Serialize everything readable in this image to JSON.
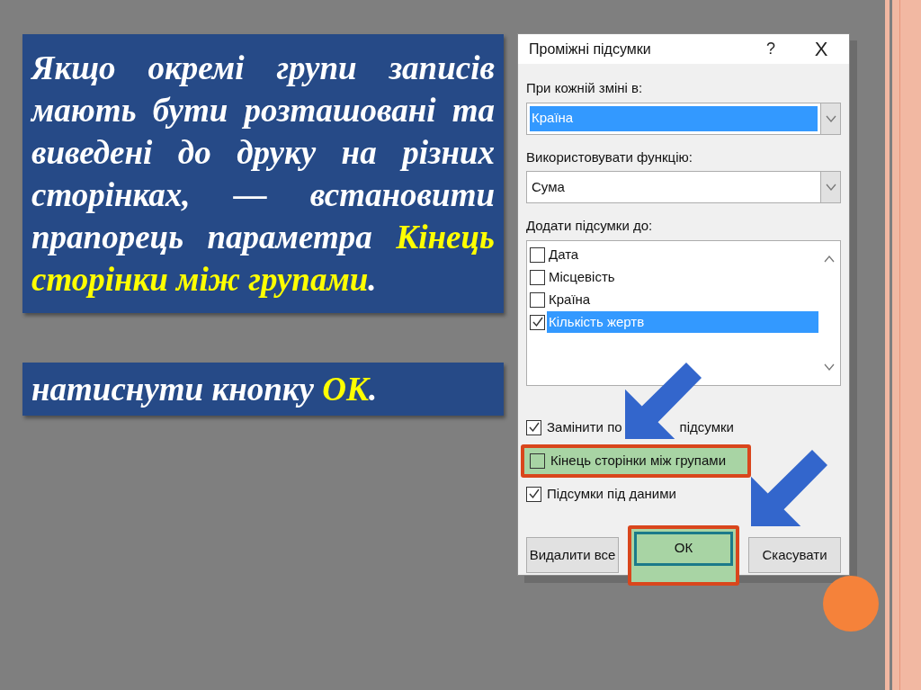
{
  "slide": {
    "paragraphs": [
      {
        "parts": [
          {
            "text": "Якщо окремі групи записів мають бути розташовані та виведені до друку на різних сторінках, — встановити прапорець параметра ",
            "highlight": false
          },
          {
            "text": "Кінець сторінки між групами",
            "highlight": true
          },
          {
            "text": ".",
            "highlight": false
          }
        ]
      },
      {
        "parts": [
          {
            "text": "натиснути кнопку ",
            "highlight": false
          },
          {
            "text": "ОК",
            "highlight": true
          },
          {
            "text": ".",
            "highlight": false
          }
        ]
      }
    ]
  },
  "dialog": {
    "title": "Проміжні підсумки",
    "help": "?",
    "close": "X",
    "group_by": {
      "label": "При кожній зміні в:",
      "value": "Країна",
      "selected": true
    },
    "function": {
      "label": "Використовувати функцію:",
      "value": "Сума",
      "selected": false
    },
    "add_to": {
      "label": "Додати підсумки до:",
      "items": [
        {
          "label": "Дата",
          "checked": false,
          "selected": false
        },
        {
          "label": "Місцевість",
          "checked": false,
          "selected": false
        },
        {
          "label": "Країна",
          "checked": false,
          "selected": false
        },
        {
          "label": "Кількість жертв",
          "checked": true,
          "selected": true
        }
      ]
    },
    "options": [
      {
        "parts": [
          "Замінити по",
          "підсумки"
        ],
        "checked": true,
        "highlighted": false
      },
      {
        "parts": [
          "Кінець сторінки між групами"
        ],
        "checked": false,
        "highlighted": true
      },
      {
        "parts": [
          "Підсумки під даними"
        ],
        "checked": true,
        "highlighted": false
      }
    ],
    "buttons": [
      {
        "label": "Видалити все",
        "highlighted": false
      },
      {
        "label": "ОК",
        "highlighted": true
      },
      {
        "label": "Скасувати",
        "highlighted": false
      }
    ]
  }
}
